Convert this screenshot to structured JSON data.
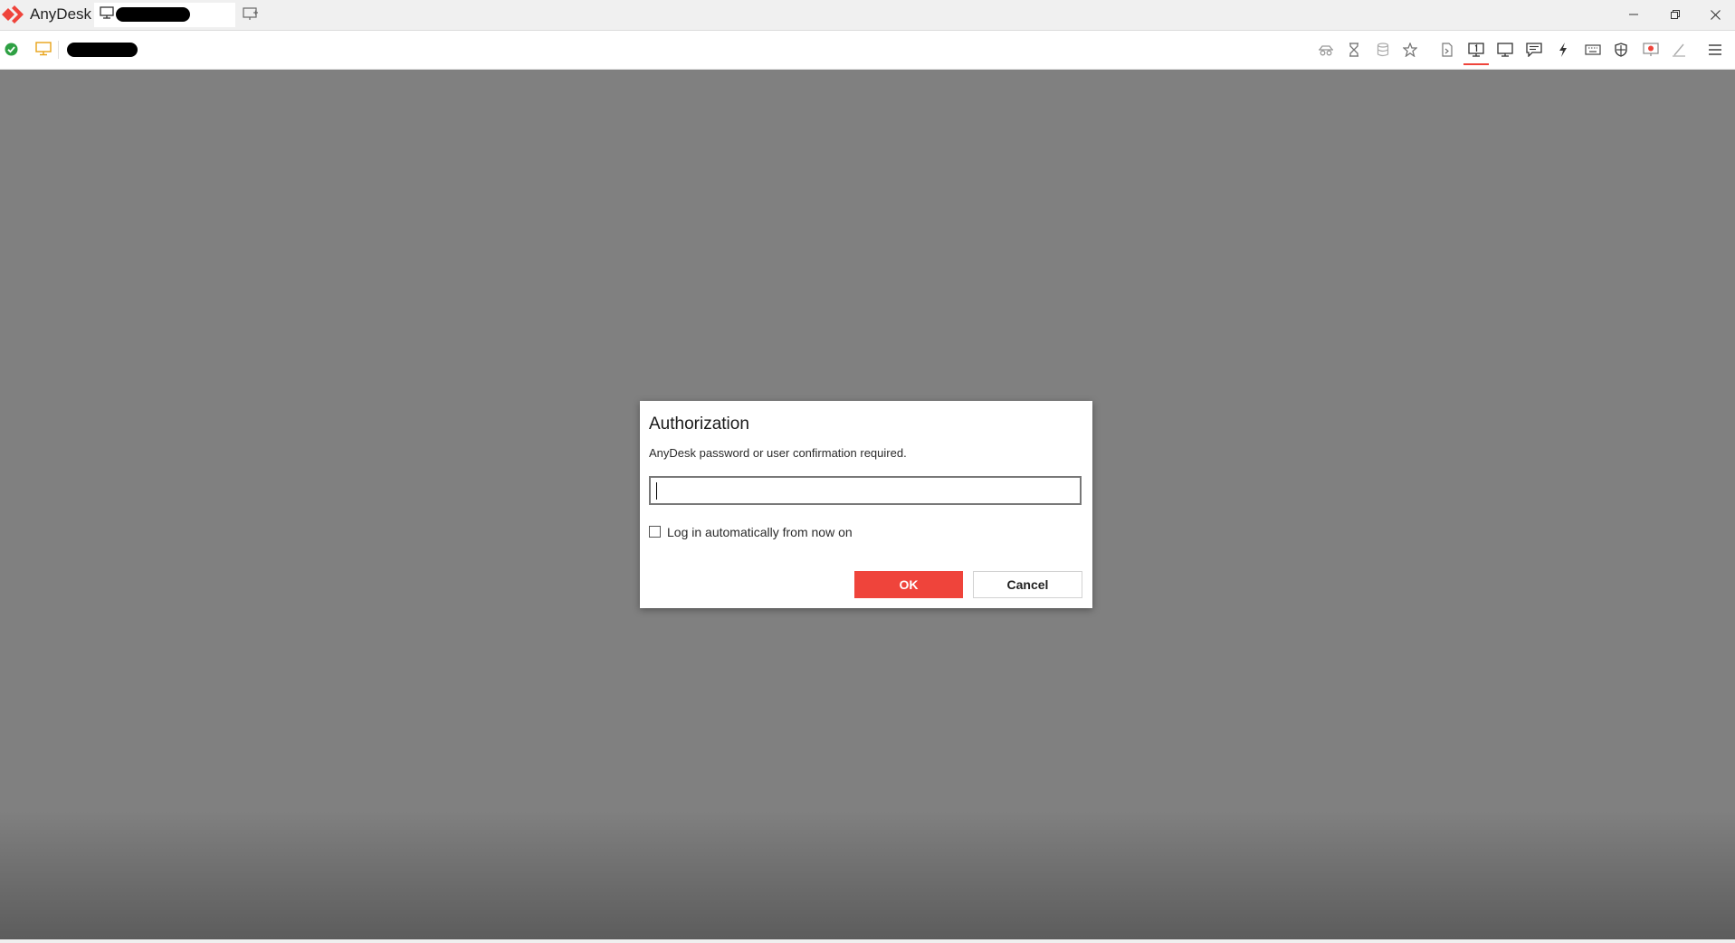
{
  "app": {
    "title": "AnyDesk",
    "accent_color": "#ef443b",
    "logo_icon": "anydesk-logo-icon"
  },
  "tab": {
    "label": "redacted",
    "icon": "monitor-icon"
  },
  "titlebar": {
    "new_tab_icon": "new-session-icon",
    "window_controls": [
      "minimize-icon",
      "restore-icon",
      "close-icon"
    ]
  },
  "toolbar": {
    "status_icon": "connected-check-icon",
    "remote_desk_icon": "remote-desk-icon",
    "address": "redacted",
    "icons": [
      "privacy-mode-icon",
      "hourglass-icon",
      "database-icon",
      "favorite-star-icon",
      "file-transfer-icon",
      "display-one-icon",
      "monitor-view-icon",
      "chat-icon",
      "actions-lightning-icon",
      "keyboard-icon",
      "permissions-shield-icon",
      "record-session-icon",
      "whiteboard-pen-icon",
      "menu-hamburger-icon"
    ],
    "active_icon": "display-one-icon"
  },
  "dialog": {
    "title": "Authorization",
    "message": "AnyDesk password or user confirmation required.",
    "password_value": "",
    "checkbox_label": "Log in automatically from now on",
    "checkbox_checked": false,
    "ok_label": "OK",
    "cancel_label": "Cancel"
  }
}
